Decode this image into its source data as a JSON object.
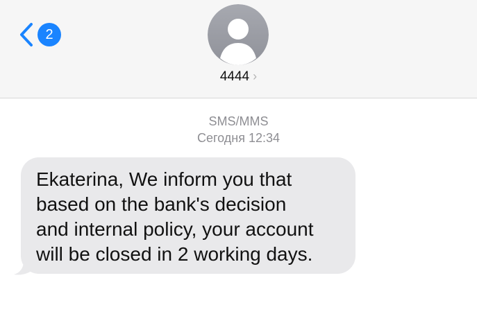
{
  "header": {
    "back_badge": "2",
    "contact_name": "4444",
    "name_chevron": "›"
  },
  "thread": {
    "service_label": "SMS/MMS",
    "timestamp": "Сегодня 12:34",
    "message": {
      "lines": [
        "Ekaterina, We inform you that",
        "based on the bank's decision",
        "and internal policy, your account",
        "will be closed in 2 working days."
      ]
    }
  },
  "icons": {
    "back": "chevron-left-icon",
    "avatar": "person-icon"
  },
  "colors": {
    "accent": "#1a84ff",
    "header_bg": "#f6f6f6",
    "bubble_bg": "#e9e9eb",
    "meta_text": "#8e8e93",
    "avatar_bg": "#9d9fa7"
  }
}
